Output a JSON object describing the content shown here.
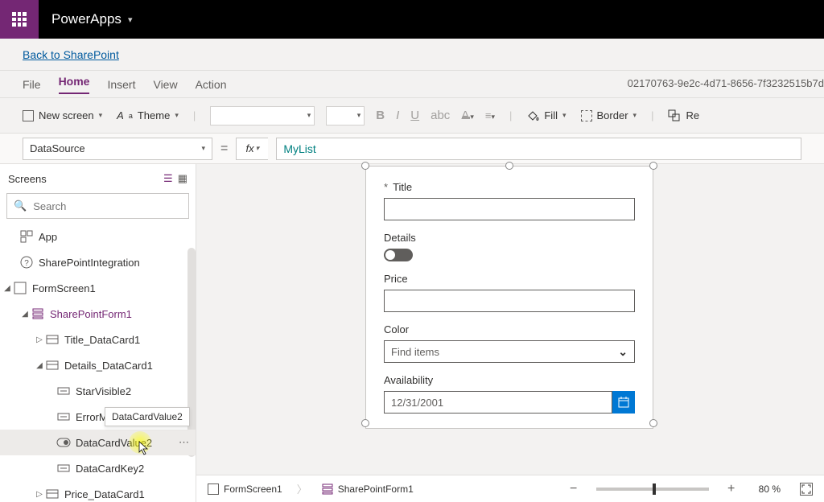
{
  "header": {
    "app_name": "PowerApps"
  },
  "back_link": "Back to SharePoint",
  "menu": {
    "file": "File",
    "home": "Home",
    "insert": "Insert",
    "view": "View",
    "action": "Action"
  },
  "file_id": "02170763-9e2c-4d71-8656-7f3232515b7d",
  "ribbon": {
    "new_screen": "New screen",
    "theme": "Theme",
    "fill": "Fill",
    "border": "Border",
    "reorder": "Re"
  },
  "formula": {
    "property": "DataSource",
    "fx": "fx",
    "value": "MyList"
  },
  "tree": {
    "title": "Screens",
    "search_placeholder": "Search",
    "app": "App",
    "sp_integration": "SharePointIntegration",
    "formscreen": "FormScreen1",
    "spform": "SharePointForm1",
    "title_dc": "Title_DataCard1",
    "details_dc": "Details_DataCard1",
    "starvisible": "StarVisible2",
    "errormsg": "ErrorM",
    "datacardvalue": "DataCardValue2",
    "datacardkey": "DataCardKey2",
    "price_dc": "Price_DataCard1",
    "tooltip": "DataCardValue2"
  },
  "form": {
    "title_label": "Title",
    "details_label": "Details",
    "price_label": "Price",
    "color_label": "Color",
    "color_placeholder": "Find items",
    "avail_label": "Availability",
    "avail_value": "12/31/2001"
  },
  "breadcrumb": {
    "screen": "FormScreen1",
    "form": "SharePointForm1"
  },
  "zoom": {
    "pct": "80 %"
  }
}
